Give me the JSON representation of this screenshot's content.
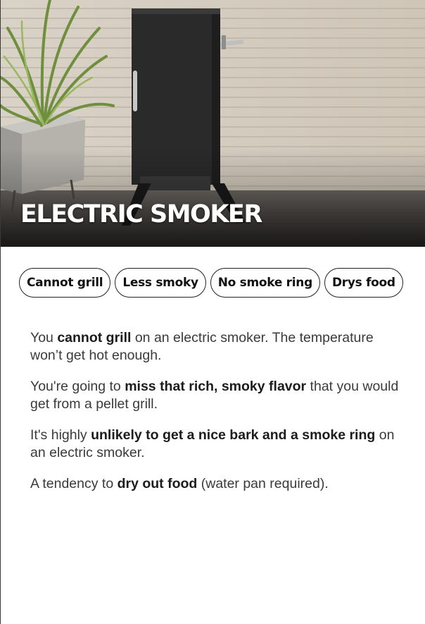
{
  "hero": {
    "title": "ELECTRIC SMOKER",
    "image": "electric smoker cabinet on patio beside potted plant"
  },
  "chips": [
    {
      "label": "Cannot grill"
    },
    {
      "label": "Less smoky"
    },
    {
      "label": "No smoke ring"
    },
    {
      "label": "Drys food"
    }
  ],
  "points": [
    {
      "pre": "You ",
      "bold": "cannot grill",
      "post": " on an electric smoker. The temperature won’t get hot enough."
    },
    {
      "pre": "You're going to ",
      "bold": "miss that rich, smoky flavor",
      "post": " that you would get from a pellet grill."
    },
    {
      "pre": "It's highly ",
      "bold": "unlikely to get a nice bark and a smoke ring",
      "post": " on an electric smoker."
    },
    {
      "pre": "A tendency to ",
      "bold": "dry out food",
      "post": " (water pan required)."
    }
  ],
  "colors": {
    "background": "#ffffff",
    "text": "#3a3a3a",
    "chip_border": "#222222",
    "title": "#ffffff"
  }
}
